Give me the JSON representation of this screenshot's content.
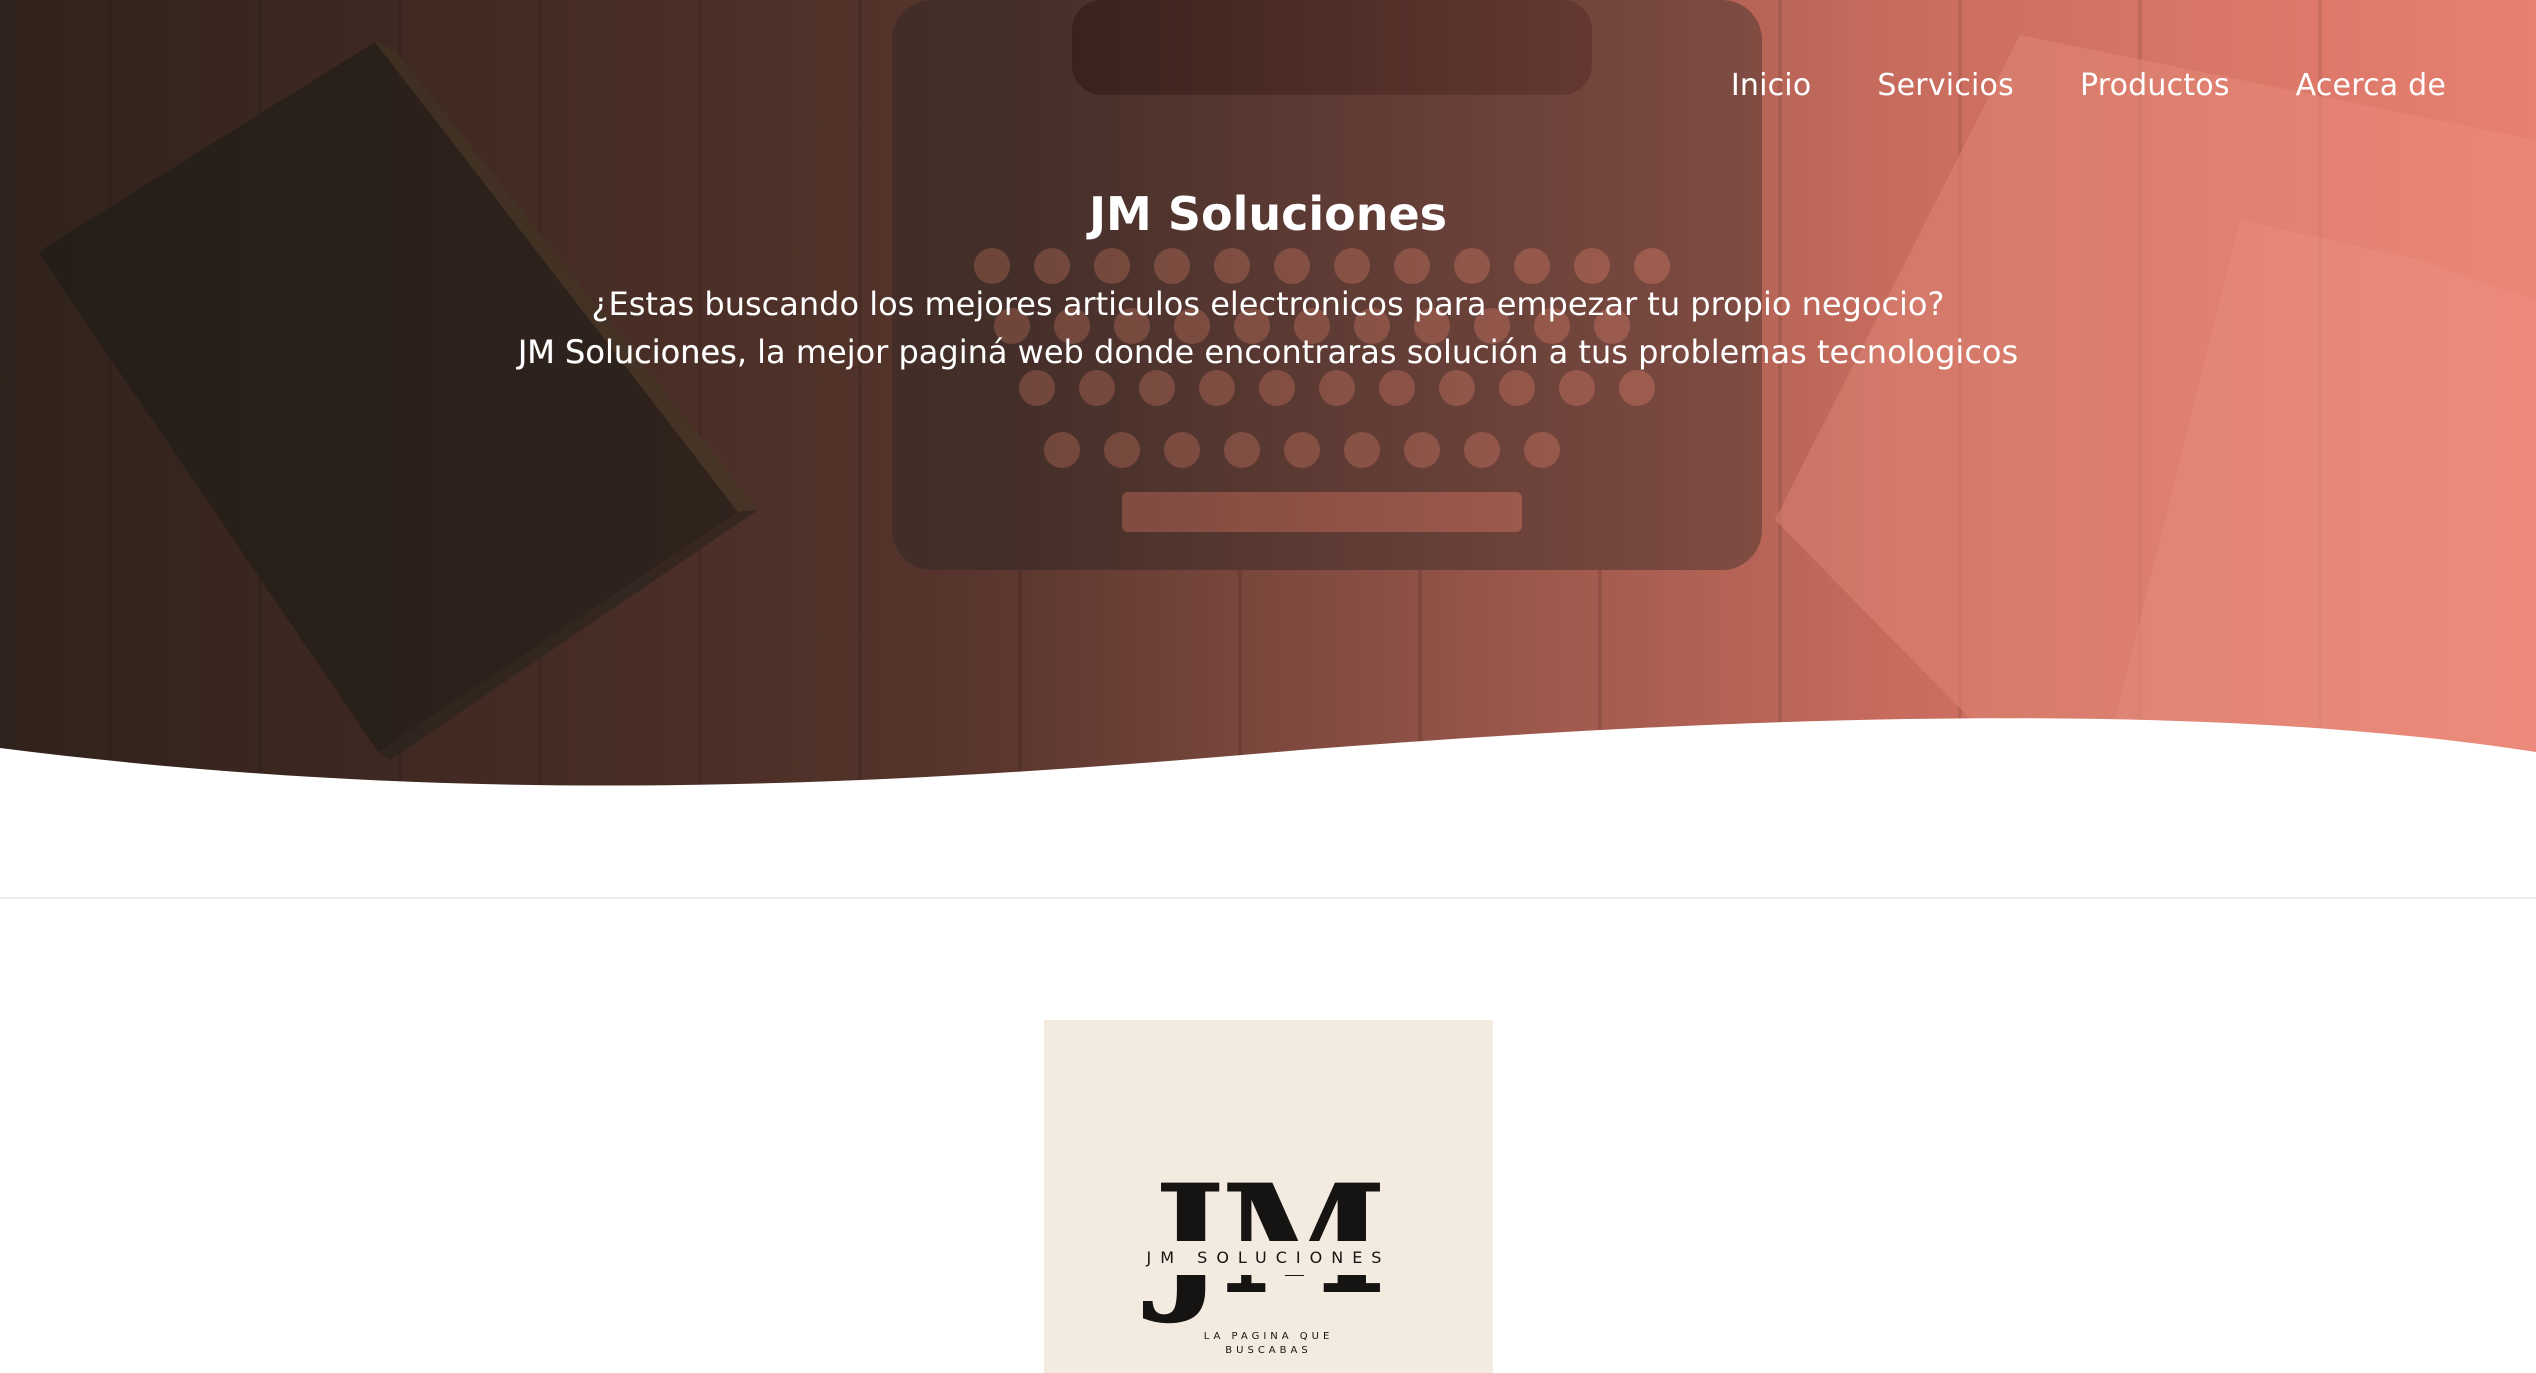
{
  "nav": {
    "items": [
      {
        "label": "Inicio"
      },
      {
        "label": "Servicios"
      },
      {
        "label": "Productos"
      },
      {
        "label": "Acerca de"
      }
    ]
  },
  "hero": {
    "title": "JM Soluciones",
    "line1": "¿Estas buscando los mejores articulos electronicos para empezar tu propio negocio?",
    "line2_brand": "JM Soluciones",
    "line2_rest": ", la mejor paginá web donde encontraras solución a tus problemas tecnologicos"
  },
  "logo": {
    "monogram": "JM",
    "name": "JM SOLUCIONES",
    "tagline_1": "LA PAGINA QUE",
    "tagline_2": "BUSCABAS"
  },
  "colors": {
    "hero_left": "#3a2a22",
    "hero_right": "#e08070",
    "logo_background": "#f3ebe0",
    "logo_ink": "#161412"
  }
}
